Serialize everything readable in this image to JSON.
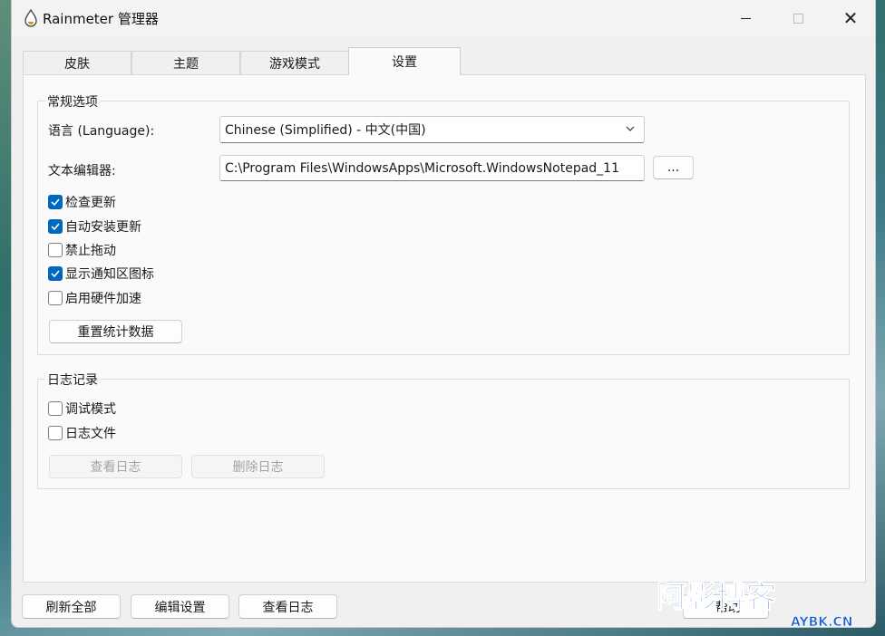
{
  "window": {
    "title": "Rainmeter 管理器"
  },
  "tabs": [
    {
      "label": "皮肤"
    },
    {
      "label": "主题"
    },
    {
      "label": "游戏模式"
    },
    {
      "label": "设置"
    }
  ],
  "general": {
    "legend": "常规选项",
    "language_label": "语言 (Language):",
    "language_value": "Chinese (Simplified) - 中文(中国)",
    "editor_label": "文本编辑器:",
    "editor_value": "C:\\Program Files\\WindowsApps\\Microsoft.WindowsNotepad_11",
    "browse_label": "...",
    "checkboxes": [
      {
        "label": "检查更新",
        "checked": true
      },
      {
        "label": "自动安装更新",
        "checked": true
      },
      {
        "label": "禁止拖动",
        "checked": false
      },
      {
        "label": "显示通知区图标",
        "checked": true
      },
      {
        "label": "启用硬件加速",
        "checked": false
      }
    ],
    "reset_stats_label": "重置统计数据"
  },
  "logging": {
    "legend": "日志记录",
    "checkboxes": [
      {
        "label": "调试模式",
        "checked": false
      },
      {
        "label": "日志文件",
        "checked": false
      }
    ],
    "view_log_label": "查看日志",
    "delete_log_label": "删除日志"
  },
  "footer": {
    "refresh_all_label": "刷新全部",
    "edit_settings_label": "编辑设置",
    "view_log_label": "查看日志",
    "help_label": "帮助"
  },
  "watermark": {
    "logo_text": "阿影博客",
    "domain_text": "AYBK.CN"
  },
  "colors": {
    "accent": "#0067c0",
    "watermark": "#1560d6"
  }
}
